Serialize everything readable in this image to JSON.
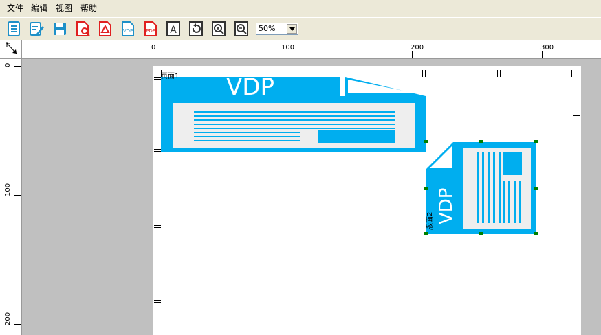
{
  "menubar": {
    "items": [
      "文件",
      "编辑",
      "视图",
      "帮助"
    ]
  },
  "toolbar": {
    "buttons": [
      {
        "name": "list-icon",
        "color": "#1e90c8"
      },
      {
        "name": "edit-icon",
        "color": "#1e90c8"
      },
      {
        "name": "save-icon",
        "color": "#1e90c8"
      },
      {
        "name": "pdf-preview-icon",
        "color": "#e02020"
      },
      {
        "name": "acrobat-icon",
        "color": "#e02020"
      },
      {
        "name": "vdp-icon",
        "color": "#1e90c8",
        "text": "VDP"
      },
      {
        "name": "pdf-icon",
        "color": "#e02020",
        "text": "PDF"
      },
      {
        "name": "text-tool-icon",
        "color": "#333333",
        "text": "A"
      },
      {
        "name": "rotate-icon",
        "color": "#333333"
      },
      {
        "name": "zoom-in-icon",
        "color": "#333333"
      },
      {
        "name": "zoom-out-icon",
        "color": "#333333"
      }
    ],
    "zoom_value": "50%"
  },
  "ruler": {
    "h_labels": [
      "0",
      "100",
      "200",
      "300"
    ],
    "v_labels": [
      "0",
      "100",
      "200"
    ]
  },
  "document": {
    "objects": [
      {
        "label": "页面1",
        "kind": "horizontal VDP icon",
        "text": "VDP"
      },
      {
        "label": "版面2",
        "kind": "vertical VDP icon",
        "text": "VDP"
      }
    ],
    "accent_color": "#00aeef"
  }
}
